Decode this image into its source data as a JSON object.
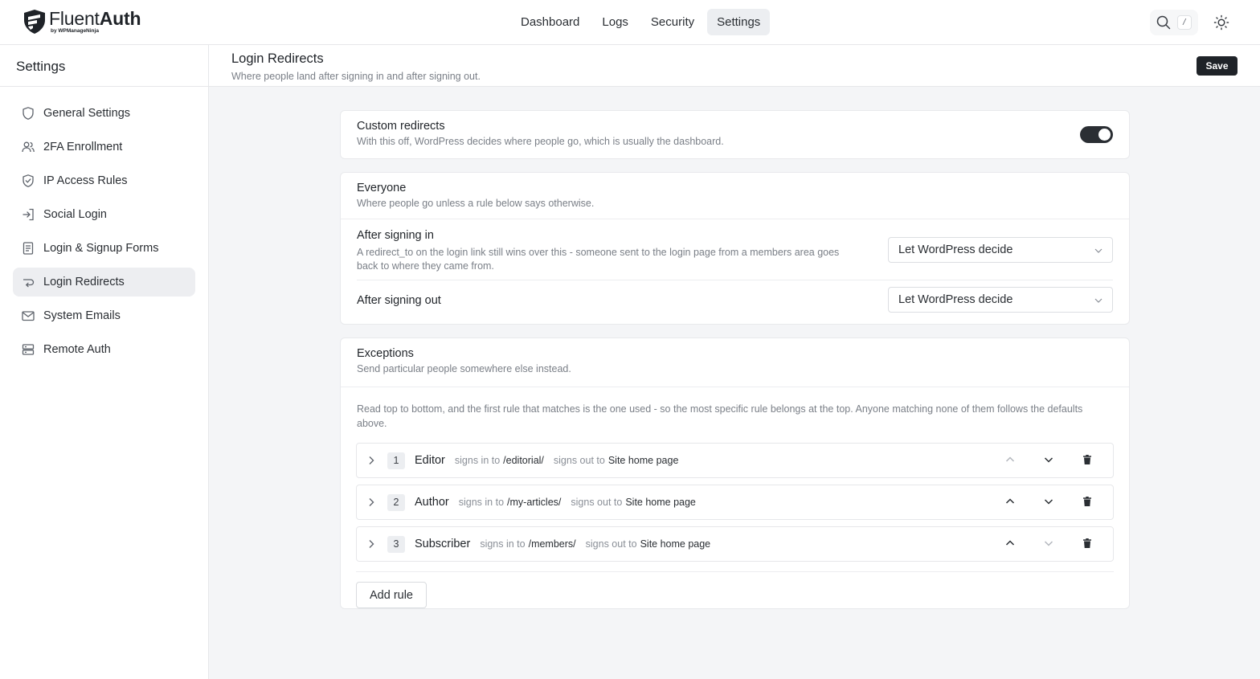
{
  "header": {
    "brand_name_light": "Fluent",
    "brand_name_bold": "Auth",
    "brand_sub": "by WPManageNinja",
    "nav": [
      {
        "label": "Dashboard",
        "active": false
      },
      {
        "label": "Logs",
        "active": false
      },
      {
        "label": "Security",
        "active": false
      },
      {
        "label": "Settings",
        "active": true
      }
    ],
    "search_shortcut": "/"
  },
  "sidebar": {
    "title": "Settings",
    "items": [
      {
        "label": "General Settings",
        "icon": "shield-icon"
      },
      {
        "label": "2FA Enrollment",
        "icon": "users-icon"
      },
      {
        "label": "IP Access Rules",
        "icon": "shield-check-icon"
      },
      {
        "label": "Social Login",
        "icon": "login-icon"
      },
      {
        "label": "Login & Signup Forms",
        "icon": "form-icon"
      },
      {
        "label": "Login Redirects",
        "icon": "redirect-icon",
        "active": true
      },
      {
        "label": "System Emails",
        "icon": "mail-icon"
      },
      {
        "label": "Remote Auth",
        "icon": "server-icon"
      }
    ]
  },
  "page": {
    "title": "Login Redirects",
    "subtitle": "Where people land after signing in and after signing out.",
    "save_label": "Save"
  },
  "custom_redirects": {
    "title": "Custom redirects",
    "desc": "With this off, WordPress decides where people go, which is usually the dashboard.",
    "enabled": true
  },
  "everyone": {
    "title": "Everyone",
    "desc": "Where people go unless a rule below says otherwise.",
    "after_in": {
      "label": "After signing in",
      "help_1": "A redirect_to on the login link still wins over this - someone sent to the login page from a members area goes",
      "help_2": "back to where they came from.",
      "value": "Let WordPress decide"
    },
    "after_out": {
      "label": "After signing out",
      "value": "Let WordPress decide"
    }
  },
  "exceptions": {
    "title": "Exceptions",
    "desc": "Send particular people somewhere else instead.",
    "note_1": "Read top to bottom, and the first rule that matches is the one used - so the most specific rule belongs at the top. Anyone matching none of them follows the defaults",
    "note_2": "above.",
    "signs_in_label": "signs in to",
    "signs_out_label": "signs out to",
    "rules": [
      {
        "num": "1",
        "role": "Editor",
        "in": "/editorial/",
        "out": "Site home page"
      },
      {
        "num": "2",
        "role": "Author",
        "in": "/my-articles/",
        "out": "Site home page"
      },
      {
        "num": "3",
        "role": "Subscriber",
        "in": "/members/",
        "out": "Site home page"
      }
    ],
    "add_label": "Add rule"
  }
}
